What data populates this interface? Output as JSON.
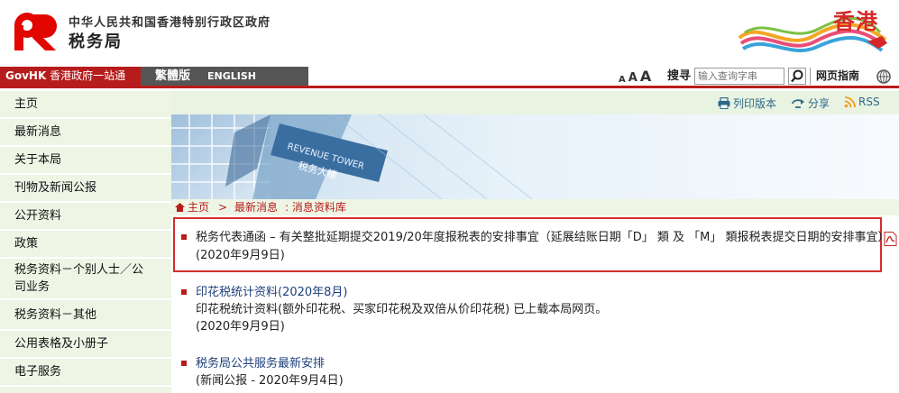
{
  "header": {
    "gov_name": "中华人民共和国香港特别行政区政府",
    "dept_name": "税务局",
    "brand_text": "香港",
    "brand_color": "#d62828"
  },
  "topbar": {
    "govhk_prefix": "GovHK",
    "govhk_text": "香港政府一站通",
    "lang_traditional": "繁體版",
    "lang_english": "ENGLISH",
    "font_small": "A",
    "font_medium": "A",
    "font_large": "A",
    "search_label": "搜寻",
    "search_placeholder": "输入查询字串",
    "site_guide": "网页指南",
    "accent_color": "#b71c1c"
  },
  "sidebar": {
    "items": [
      {
        "label": "主页"
      },
      {
        "label": "最新消息"
      },
      {
        "label": "关于本局"
      },
      {
        "label": "刊物及新闻公报"
      },
      {
        "label": "公开资料"
      },
      {
        "label": "政策"
      },
      {
        "label_line1": "税务资料－个别人士／公",
        "label_line2": "司业务"
      },
      {
        "label": "税务资料－其他"
      },
      {
        "label": "公用表格及小册子"
      },
      {
        "label": "电子服务"
      }
    ]
  },
  "utility": {
    "print": "列印版本",
    "share": "分享",
    "rss": "RSS"
  },
  "banner": {
    "sign_en": "REVENUE TOWER",
    "sign_zh": "税务大楼"
  },
  "breadcrumb": {
    "home": "主页",
    "separator": ">",
    "news": "最新消息",
    "current": ": 消息资料库"
  },
  "news": [
    {
      "title": "税务代表通函 – 有关整批延期提交2019/20年度报税表的安排事宜（延展结账日期「D」 類 及 「M」 類报税表提交日期的安排事宜）",
      "date": "(2020年9月9日)",
      "icon": "pdf-icon"
    },
    {
      "title": "印花税统计资料(2020年8月)",
      "desc": "印花税统计资料(额外印花税、买家印花税及双倍从价印花税) 已上载本局网页。",
      "date": "(2020年9月9日)"
    },
    {
      "title": "税务局公共服务最新安排",
      "date": "(新闻公报 - 2020年9月4日)"
    }
  ]
}
